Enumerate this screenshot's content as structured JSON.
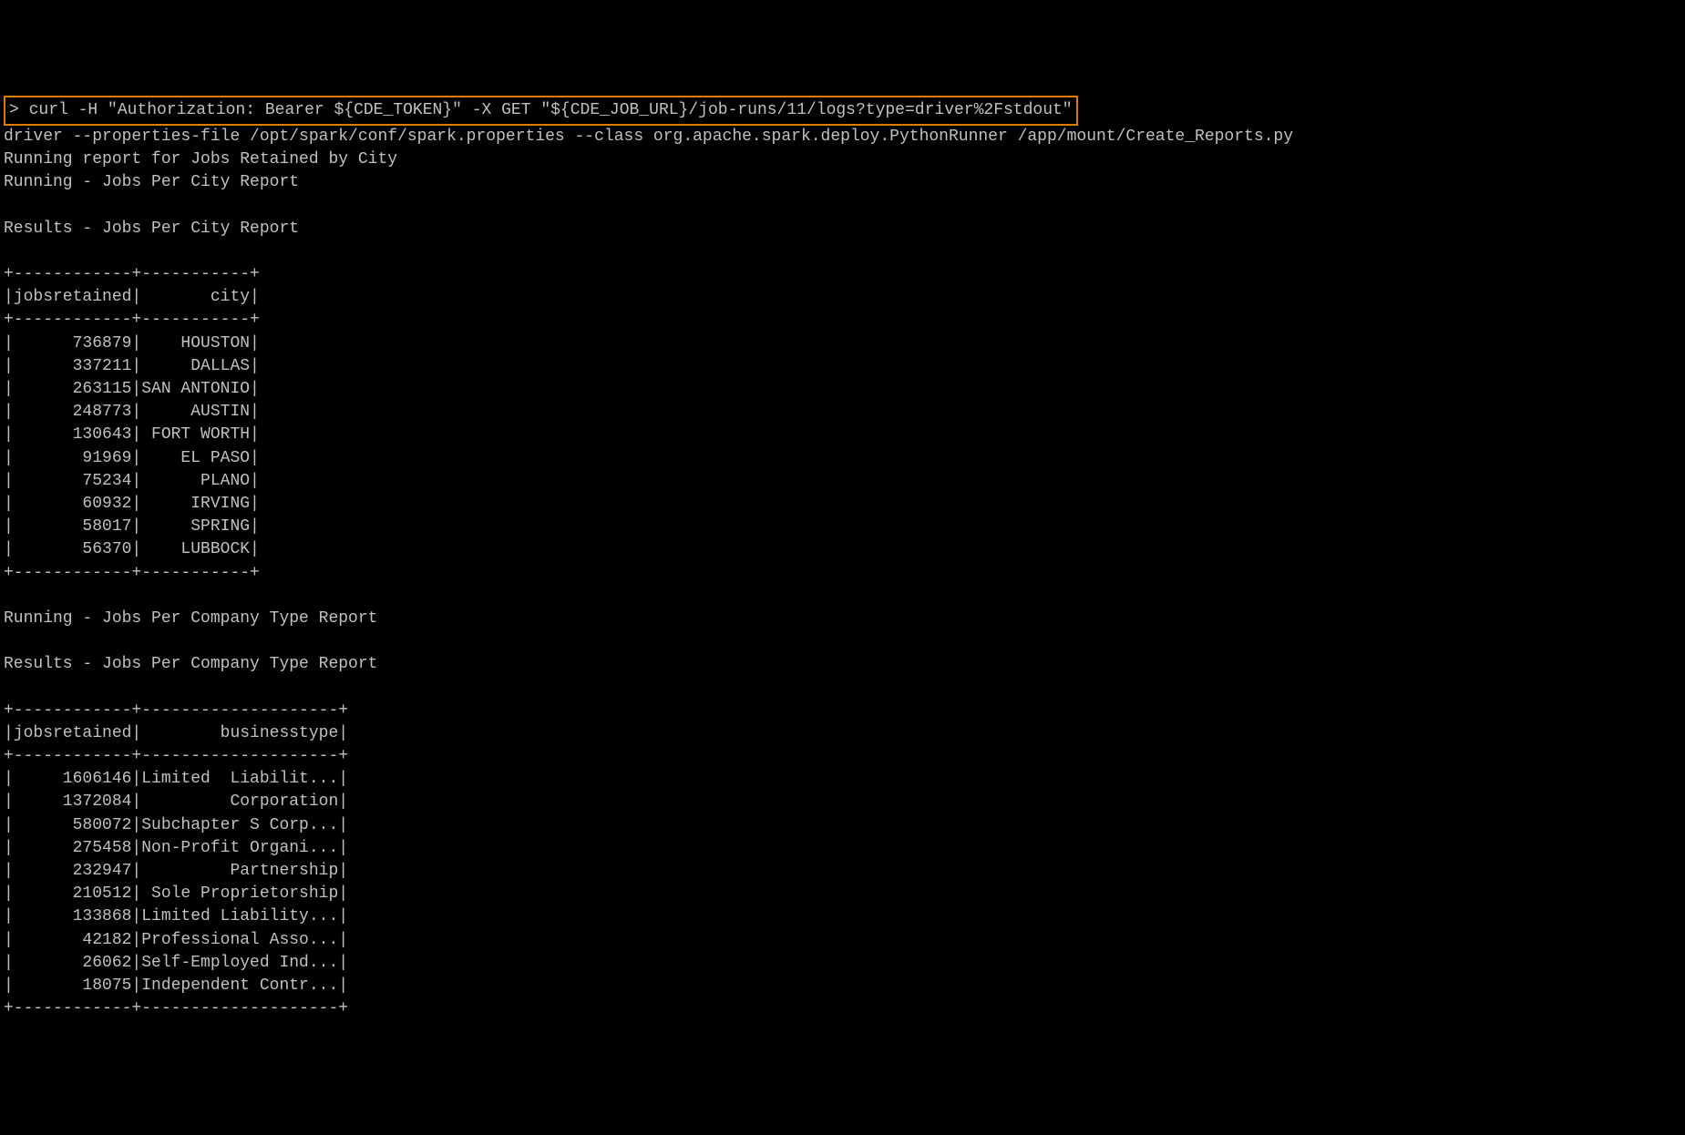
{
  "command": {
    "prompt": ">",
    "text": "curl -H \"Authorization: Bearer ${CDE_TOKEN}\" -X GET \"${CDE_JOB_URL}/job-runs/11/logs?type=driver%2Fstdout\""
  },
  "output": {
    "driver_line": "driver --properties-file /opt/spark/conf/spark.properties --class org.apache.spark.deploy.PythonRunner /app/mount/Create_Reports.py",
    "running_report": "Running report for Jobs Retained by City",
    "section1_running": "Running - Jobs Per City Report",
    "section1_results": "Results - Jobs Per City Report",
    "table1": {
      "separator": "+------------+-----------+",
      "header": "|jobsretained|       city|",
      "rows": [
        "|      736879|    HOUSTON|",
        "|      337211|     DALLAS|",
        "|      263115|SAN ANTONIO|",
        "|      248773|     AUSTIN|",
        "|      130643| FORT WORTH|",
        "|       91969|    EL PASO|",
        "|       75234|      PLANO|",
        "|       60932|     IRVING|",
        "|       58017|     SPRING|",
        "|       56370|    LUBBOCK|"
      ]
    },
    "section2_running": "Running - Jobs Per Company Type Report",
    "section2_results": "Results - Jobs Per Company Type Report",
    "table2": {
      "separator": "+------------+--------------------+",
      "header": "|jobsretained|        businesstype|",
      "rows": [
        "|     1606146|Limited  Liabilit...|",
        "|     1372084|         Corporation|",
        "|      580072|Subchapter S Corp...|",
        "|      275458|Non-Profit Organi...|",
        "|      232947|         Partnership|",
        "|      210512| Sole Proprietorship|",
        "|      133868|Limited Liability...|",
        "|       42182|Professional Asso...|",
        "|       26062|Self-Employed Ind...|",
        "|       18075|Independent Contr...|"
      ]
    }
  }
}
